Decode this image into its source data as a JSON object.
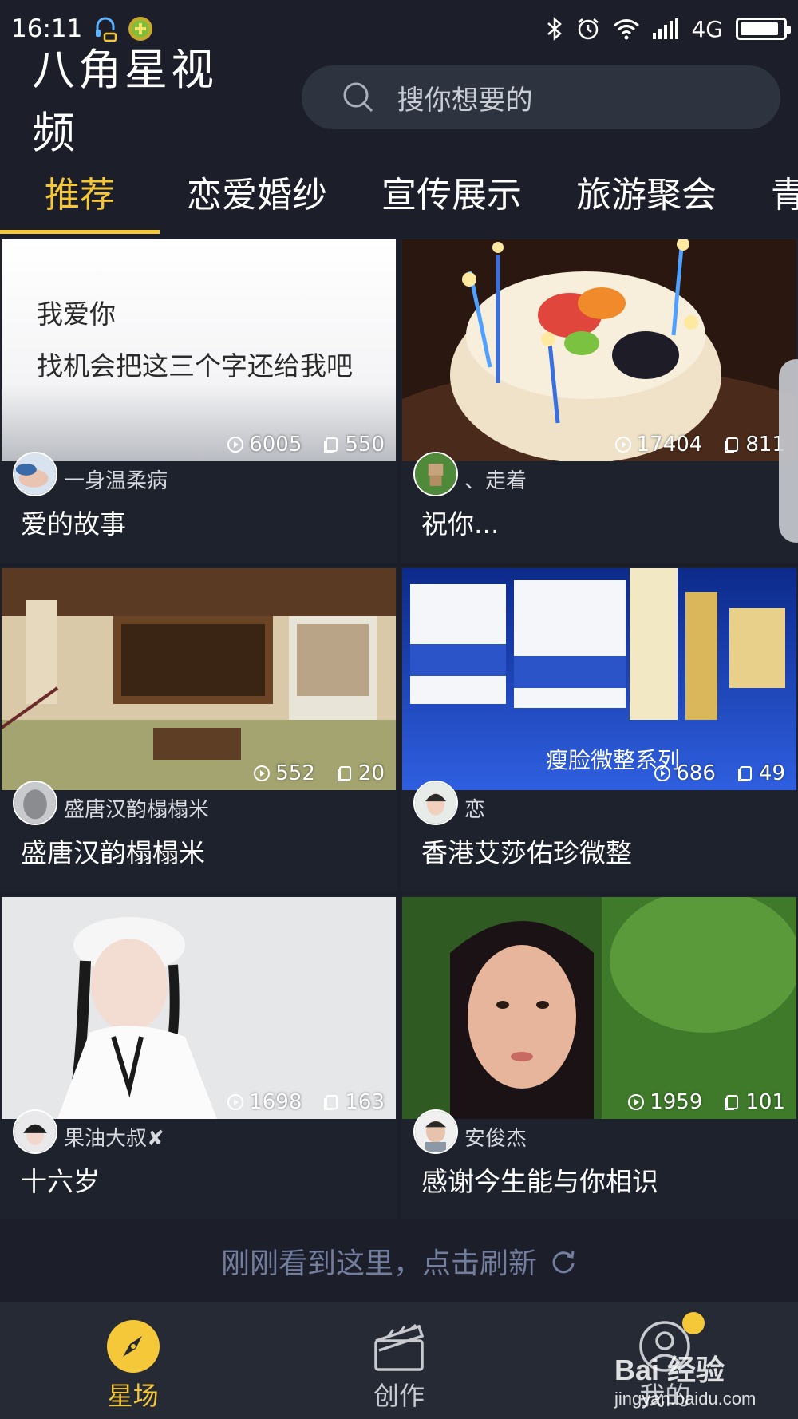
{
  "status_bar": {
    "time": "16:11",
    "network": "4G",
    "icons": [
      "headset-icon",
      "plus-badge-icon",
      "bluetooth-icon",
      "alarm-icon",
      "wifi-icon",
      "signal-icon",
      "battery-icon"
    ],
    "battery_level": 0.9
  },
  "header": {
    "title": "八角星视频",
    "search_placeholder": "搜你想要的"
  },
  "tabs": [
    "推荐",
    "恋爱婚纱",
    "宣传展示",
    "旅游聚会",
    "青"
  ],
  "active_tab": 0,
  "videos": [
    {
      "author": "一身温柔病",
      "title": "爱的故事",
      "plays": "6005",
      "shares": "550",
      "thumb_line1": "我爱你",
      "thumb_line2": "找机会把这三个字还给我吧"
    },
    {
      "author": "、走着",
      "title": "祝你...",
      "plays": "17404",
      "shares": "811"
    },
    {
      "author": "盛唐汉韵榻榻米",
      "title": "盛唐汉韵榻榻米",
      "plays": "552",
      "shares": "20"
    },
    {
      "author": "恋",
      "title": "香港艾莎佑珍微整",
      "plays": "686",
      "shares": "49",
      "thumb_caption": "瘦脸微整系列"
    },
    {
      "author": "果油大叔✘",
      "title": "十六岁",
      "plays": "1698",
      "shares": "163"
    },
    {
      "author": "安俊杰",
      "title": "感谢今生能与你相识",
      "plays": "1959",
      "shares": "101"
    }
  ],
  "refresh_text": "刚刚看到这里，点击刷新",
  "bottom_nav": [
    {
      "label": "星场",
      "icon": "compass-icon",
      "active": true
    },
    {
      "label": "创作",
      "icon": "clapperboard-icon",
      "active": false
    },
    {
      "label": "我的",
      "icon": "user-icon",
      "active": false
    }
  ],
  "watermark": {
    "main": "Bai 经验",
    "sub": "jingyan.baidu.com"
  },
  "colors": {
    "background": "#1c1f2a",
    "accent": "#f5c83a",
    "card": "#1e222d",
    "muted_text": "#737d9e"
  }
}
